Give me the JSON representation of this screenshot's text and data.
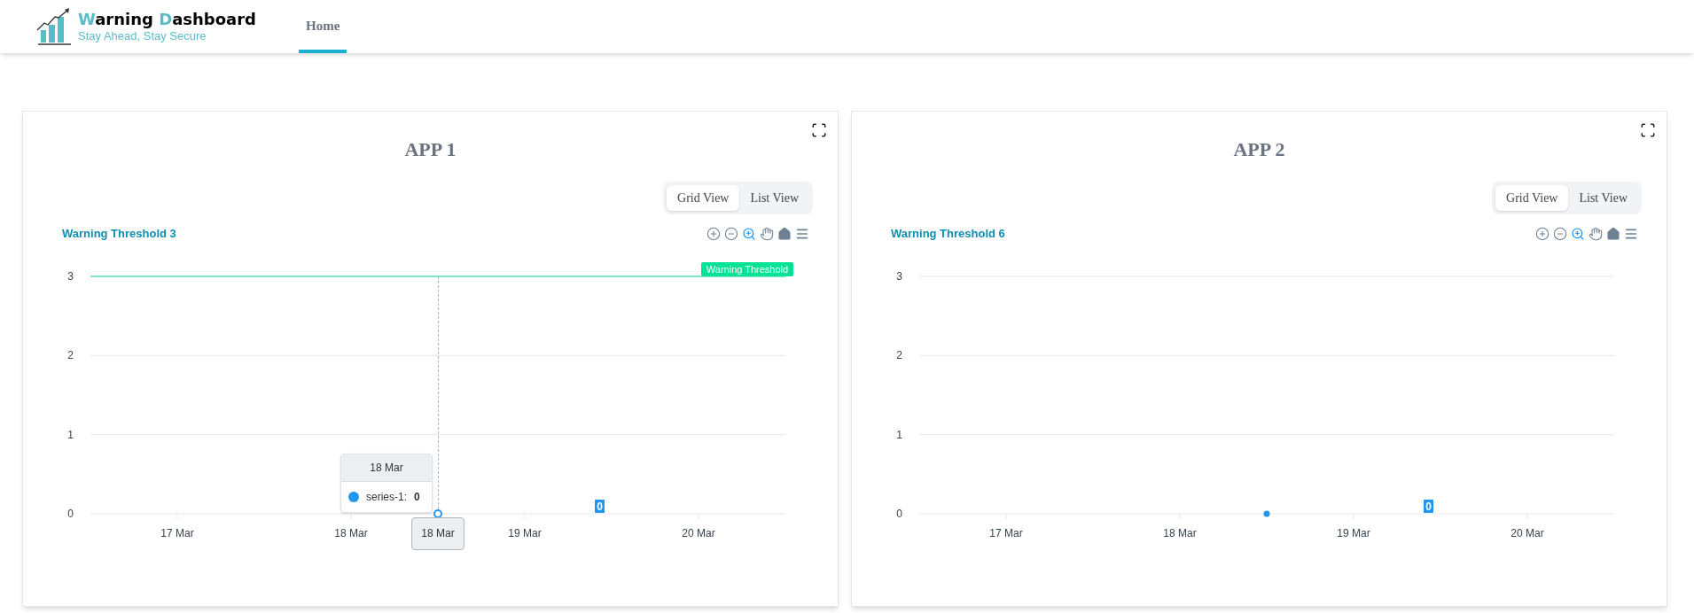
{
  "header": {
    "brand_title": "Warning Dashboard",
    "brand_tagline": "Stay Ahead, Stay Secure",
    "nav": [
      {
        "label": "Home",
        "selected": true
      }
    ]
  },
  "apps": [
    {
      "title": "APP 1",
      "view_toggle": [
        {
          "label": "Grid View",
          "selected": true
        },
        {
          "label": "List View",
          "selected": false
        }
      ],
      "chart_title": "Warning Threshold 3",
      "tools": [
        {
          "kind": "zoom-in",
          "selected": false
        },
        {
          "kind": "zoom-out",
          "selected": false
        },
        {
          "kind": "zoom",
          "selected": true
        },
        {
          "kind": "pan",
          "selected": false
        },
        {
          "kind": "reset",
          "selected": false
        },
        {
          "kind": "menu",
          "selected": false
        }
      ],
      "tooltip": {
        "title": "18 Mar",
        "separator": ":",
        "value": "0",
        "axis_label": "18 Mar"
      },
      "chart_data": {
        "type": "line",
        "categories": [
          "17 Mar",
          null,
          "18 Mar",
          null,
          "19 Mar",
          null,
          "20 Mar"
        ],
        "series": [
          {
            "name": "series-1",
            "color": "#2196f3",
            "marker": true,
            "values": [
              null,
              null,
              null,
              0,
              null,
              null,
              null
            ]
          }
        ],
        "ylim": [
          0,
          3
        ],
        "yticks": [
          {
            "value": 0,
            "label": "0"
          },
          {
            "value": 1,
            "label": "1"
          },
          {
            "value": 2,
            "label": "2"
          },
          {
            "value": 3,
            "label": "3"
          }
        ],
        "value_labels": [
          "0"
        ],
        "ref_lines": [
          {
            "label": "Warning Threshold"
          }
        ]
      }
    },
    {
      "title": "APP 2",
      "view_toggle": [
        {
          "label": "Grid View",
          "selected": true
        },
        {
          "label": "List View",
          "selected": false
        }
      ],
      "chart_title": "Warning Threshold 6",
      "tools": [
        {
          "kind": "zoom-in",
          "selected": false
        },
        {
          "kind": "zoom-out",
          "selected": false
        },
        {
          "kind": "zoom",
          "selected": true
        },
        {
          "kind": "pan",
          "selected": false
        },
        {
          "kind": "reset",
          "selected": false
        },
        {
          "kind": "menu",
          "selected": false
        }
      ],
      "chart_data": {
        "type": "line",
        "categories": [
          "17 Mar",
          null,
          "18 Mar",
          null,
          "19 Mar",
          null,
          "20 Mar"
        ],
        "series": [
          {
            "color": "#2196f3",
            "marker": true,
            "values": [
              null,
              null,
              null,
              0,
              null,
              null,
              null
            ]
          }
        ],
        "ylim": [
          0,
          3
        ],
        "yticks": [
          {
            "value": 0,
            "label": "0"
          },
          {
            "value": 1,
            "label": "1"
          },
          {
            "value": 2,
            "label": "2"
          },
          {
            "value": 3,
            "label": "3"
          }
        ],
        "value_labels": [
          "0"
        ]
      }
    }
  ]
}
